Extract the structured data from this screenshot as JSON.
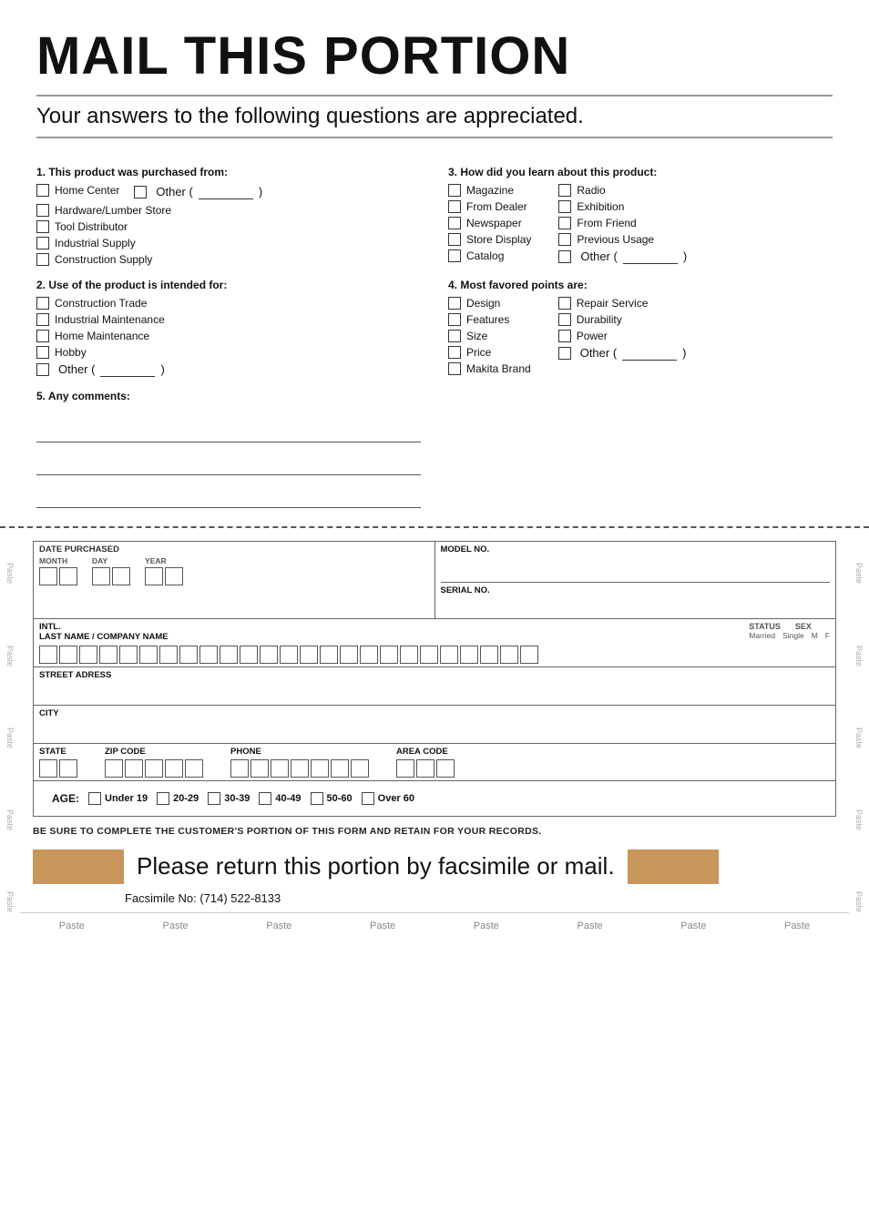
{
  "header": {
    "title": "MAIL THIS PORTION",
    "subtitle": "Your answers to the following questions are appreciated."
  },
  "q1": {
    "title": "1. This product was purchased from:",
    "options": [
      "Home Center",
      "Hardware/Lumber Store",
      "Tool Distributor",
      "Industrial Supply",
      "Construction Supply"
    ],
    "other_label": "Other (",
    "other_close": ")"
  },
  "q2": {
    "title": "2. Use of the product is intended for:",
    "options": [
      "Construction Trade",
      "Industrial Maintenance",
      "Home Maintenance",
      "Hobby"
    ],
    "other_label": "Other (",
    "other_close": ")"
  },
  "q3": {
    "title": "3. How did you learn about this product:",
    "col1": [
      "Magazine",
      "From Dealer",
      "Newspaper",
      "Store Display",
      "Catalog"
    ],
    "col2": [
      "Radio",
      "Exhibition",
      "From Friend",
      "Previous Usage"
    ],
    "other_label": "Other (",
    "other_close": ")"
  },
  "q4": {
    "title": "4. Most favored points are:",
    "col1": [
      "Design",
      "Features",
      "Size",
      "Price",
      "Makita Brand"
    ],
    "col2": [
      "Repair Service",
      "Durability",
      "Power"
    ],
    "other_label": "Other (",
    "other_close": ")"
  },
  "q5": {
    "title": "5. Any comments:"
  },
  "lower_form": {
    "date_purchased": "DATE PURCHASED",
    "month_label": "MONTH",
    "day_label": "DAY",
    "year_label": "YEAR",
    "model_no_label": "MODEL NO.",
    "serial_no_label": "SERIAL NO.",
    "intl_label": "INTL.",
    "last_name_label": "LAST NAME / COMPANY NAME",
    "status_label": "STATUS",
    "married_label": "Married",
    "single_label": "Single",
    "sex_label": "SEX",
    "m_label": "M",
    "f_label": "F",
    "street_label": "STREET ADRESS",
    "city_label": "CITY",
    "state_label": "STATE",
    "zip_label": "ZIP CODE",
    "phone_label": "PHONE",
    "area_code_label": "AREA CODE",
    "age_label": "AGE:",
    "age_options": [
      "Under 19",
      "20-29",
      "30-39",
      "40-49",
      "50-60",
      "Over 60"
    ]
  },
  "bottom": {
    "notice": "BE SURE TO COMPLETE THE CUSTOMER'S PORTION OF THIS FORM AND RETAIN FOR YOUR RECORDS.",
    "return_text": "Please return this portion by facsimile or mail.",
    "fax_text": "Facsimile No: (714) 522-8133",
    "paste_labels": [
      "Paste",
      "Paste",
      "Paste",
      "Paste",
      "Paste",
      "Paste",
      "Paste",
      "Paste"
    ]
  },
  "paste_side_labels": [
    "Paste",
    "Paste",
    "Paste",
    "Paste",
    "Paste",
    "Paste"
  ]
}
